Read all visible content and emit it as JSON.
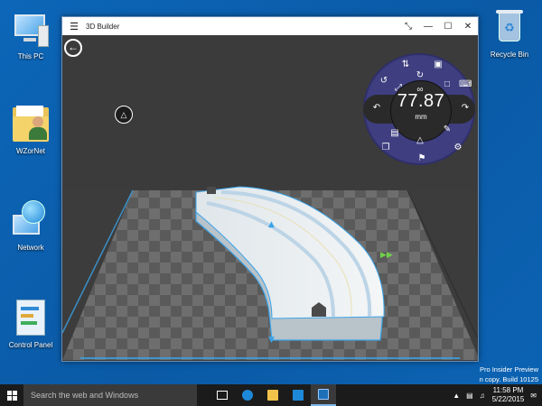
{
  "desktop": {
    "icons": [
      {
        "label": "This PC"
      },
      {
        "label": "WZorNet"
      },
      {
        "label": "Network"
      },
      {
        "label": "Control Panel"
      },
      {
        "label": "Recycle Bin"
      }
    ],
    "watermark": {
      "line1": "Pro Insider Preview",
      "line2": "n copy. Build 10125"
    }
  },
  "window": {
    "title": "3D Builder",
    "menu_icon": "hamburger-icon",
    "buttons": [
      "expand-icon",
      "minimize-icon",
      "maximize-icon",
      "close-icon"
    ]
  },
  "radial_menu": {
    "value": "77.87",
    "unit": "mm",
    "icons": [
      "mirror-icon",
      "save-icon",
      "rotate-left-icon",
      "rotate-icon",
      "select-box-icon",
      "move-icon",
      "link-icon",
      "keyboard-icon",
      "undo-icon",
      "redo-icon",
      "paste-icon",
      "edit-icon",
      "copy-icon",
      "triangle-icon",
      "settings-icon",
      "flag-icon"
    ]
  },
  "viewport": {
    "back_icon": "back-arrow-icon",
    "triangle_button_icon": "triangle-icon",
    "colors": {
      "grid_dark": "#555555",
      "grid_light": "#707070",
      "model": "#e8eef2",
      "edge": "#3aa3e8"
    }
  },
  "taskbar": {
    "search_placeholder": "Search the web and Windows",
    "time": "11:58 PM",
    "date": "5/22/2015"
  }
}
